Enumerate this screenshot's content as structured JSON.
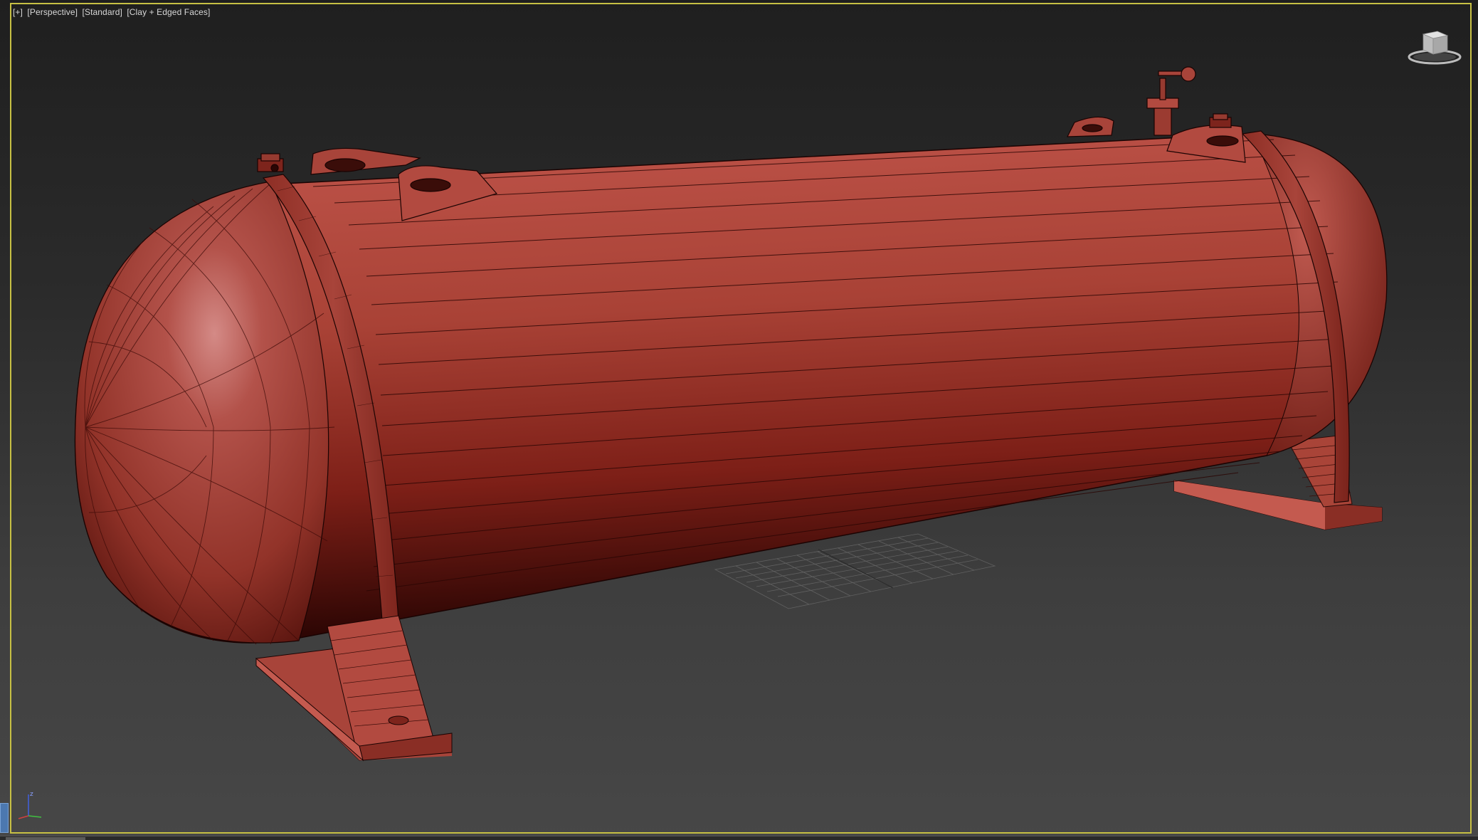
{
  "viewport": {
    "labels": [
      "[+]",
      "[Perspective]",
      "[Standard]",
      "[Clay + Edged Faces]"
    ],
    "active_border_color": "#c7c044"
  },
  "scene": {
    "object": "horizontal storage tank",
    "object_color": "#b5453b",
    "background_top": "#1f1f1f",
    "background_bottom": "#474747"
  },
  "viewcube": {
    "icon": "viewcube-icon"
  },
  "axis_tripod": {
    "icon": "axis-tripod-icon",
    "z_label": "z",
    "x_color": "#d04040",
    "y_color": "#40c040",
    "z_color": "#4060e0"
  }
}
